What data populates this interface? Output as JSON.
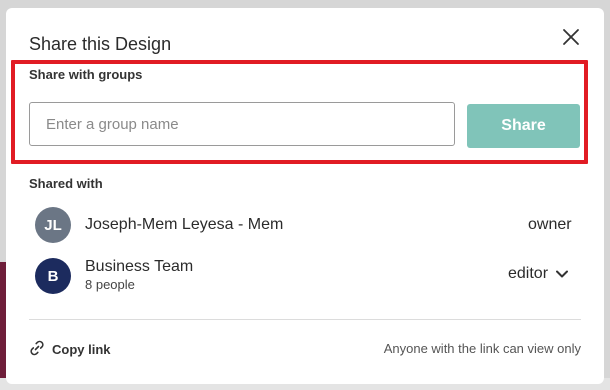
{
  "dialog": {
    "title": "Share this Design"
  },
  "groups": {
    "label": "Share with groups",
    "input_placeholder": "Enter a group name",
    "input_value": "",
    "share_button": "Share"
  },
  "shared_with": {
    "label": "Shared with",
    "members": [
      {
        "initials": "JL",
        "name": "Joseph-Mem Leyesa - Mem",
        "subtitle": "",
        "role": "owner",
        "avatar_color": "#6b7685"
      },
      {
        "initials": "B",
        "name": "Business Team",
        "subtitle": "8 people",
        "role": "editor",
        "avatar_color": "#1c2b5e"
      }
    ]
  },
  "footer": {
    "copy_link": "Copy link",
    "note": "Anyone with the link can view only"
  },
  "colors": {
    "share_button": "#80c4b9",
    "highlight": "#e11c24"
  }
}
